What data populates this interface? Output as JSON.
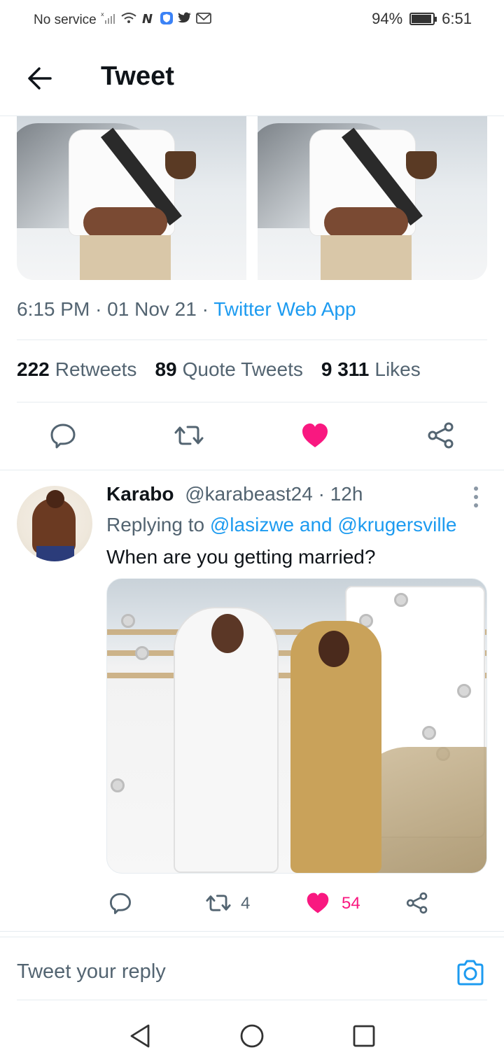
{
  "status_bar": {
    "carrier": "No service",
    "battery": "94%",
    "battery_level": 0.94,
    "time": "6:51",
    "icons": [
      "signal-icon",
      "wifi-icon",
      "nfc-icon",
      "shield-icon",
      "twitter-icon",
      "gmail-icon"
    ]
  },
  "header": {
    "title": "Tweet"
  },
  "tweet": {
    "time": "6:15 PM",
    "date": "01 Nov 21",
    "source": "Twitter Web App",
    "stats": {
      "retweets_count": "222",
      "retweets_label": "Retweets",
      "quotes_count": "89",
      "quotes_label": "Quote Tweets",
      "likes_count": "9 311",
      "likes_label": "Likes"
    }
  },
  "reply": {
    "name": "Karabo",
    "handle": "@karabeast24",
    "time_ago": "12h",
    "replying_prefix": "Replying to",
    "replying_handles": "@lasizwe and @krugersville",
    "text": "When are you getting married?",
    "retweet_count": "4",
    "like_count": "54"
  },
  "compose": {
    "placeholder": "Tweet your reply"
  },
  "colors": {
    "accent": "#1d9bf0",
    "like": "#f91880",
    "secondary_text": "#536471",
    "primary_text": "#0f1419"
  }
}
